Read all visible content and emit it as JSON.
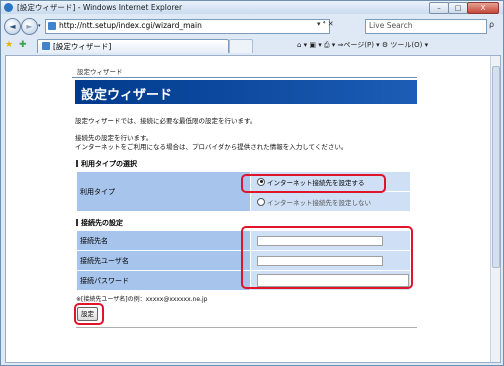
{
  "window": {
    "title": "[設定ウィザード] - Windows Internet Explorer",
    "min_glyph": "–",
    "max_glyph": "□",
    "close_glyph": "X"
  },
  "address_bar": {
    "back_glyph": "◄",
    "forward_glyph": "►",
    "url": "http://ntt.setup/index.cgi/wizard_main",
    "tools": "▾ ⁴ ✕"
  },
  "search": {
    "placeholder": "Live Search",
    "icon_glyph": "ρ"
  },
  "tabs": {
    "active_label": "[設定ウィザード]"
  },
  "command_bar": {
    "text": "⌂ ▾ ▣ ▾ ⎙ ▾ ⇒ページ(P) ▾ ⚙ ツール(O) ▾"
  },
  "page": {
    "breadcrumb": "設定ウィザード",
    "title": "設定ウィザード",
    "intro": "設定ウィザードでは、接続に必要な最低限の設定を行います。",
    "connection_note_1": "接続先の設定を行います。",
    "connection_note_2": "インターネットをご利用になる場合は、プロバイダから提供された情報を入力してください。",
    "usage_type": {
      "section_title": "利用タイプの選択",
      "label": "利用タイプ",
      "option_set": "インターネット接続先を設定する",
      "option_none": "インターネット接続先を設定しない",
      "selected": "インターネット接続先を設定する"
    },
    "connection": {
      "section_title": "接続先の設定",
      "name_label": "接続先名",
      "user_label": "接続先ユーザ名",
      "password_label": "接続パスワード",
      "name_value": "",
      "user_value": "",
      "password_value": ""
    },
    "example_note": "※[接続先ユーザ名]の例：xxxxx@xxxxxx.ne.jp",
    "submit_label": "設定"
  },
  "colors": {
    "banner": "#003a8c",
    "label_cell": "#a6c4ec",
    "value_cell": "#cfe0f6",
    "highlight": "#e0142a"
  }
}
